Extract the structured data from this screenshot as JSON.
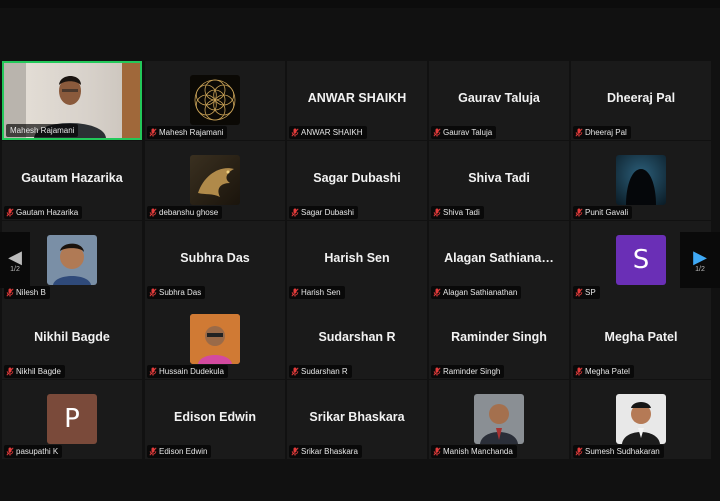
{
  "colors": {
    "background": "#111111",
    "tile": "#1a1a1a",
    "active_border": "#23c85a",
    "mic_muted": "#e23b3b",
    "avatar_s": "#6a2fb6",
    "avatar_p": "#7a4a3a",
    "nav_arrow_right": "#3fa9f5"
  },
  "pager": {
    "left": "1/2",
    "right": "1/2"
  },
  "tiles": [
    {
      "big": "",
      "label": "Mahesh Rajamani",
      "type": "video"
    },
    {
      "big": "",
      "label": "Mahesh Rajamani",
      "type": "image-flower"
    },
    {
      "big": "ANWAR SHAIKH",
      "label": "ANWAR SHAIKH",
      "type": "name"
    },
    {
      "big": "Gaurav Taluja",
      "label": "Gaurav Taluja",
      "type": "name"
    },
    {
      "big": "Dheeraj Pal",
      "label": "Dheeraj Pal",
      "type": "name"
    },
    {
      "big": "Gautam Hazarika",
      "label": "Gautam Hazarika",
      "type": "name"
    },
    {
      "big": "",
      "label": "debanshu ghose",
      "type": "image-dragon"
    },
    {
      "big": "Sagar Dubashi",
      "label": "Sagar Dubashi",
      "type": "name"
    },
    {
      "big": "Shiva Tadi",
      "label": "Shiva Tadi",
      "type": "name"
    },
    {
      "big": "",
      "label": "Punit Gavali",
      "type": "image-hacker"
    },
    {
      "big": "",
      "label": "Nilesh B",
      "type": "image-person1"
    },
    {
      "big": "Subhra Das",
      "label": "Subhra Das",
      "type": "name"
    },
    {
      "big": "Harish Sen",
      "label": "Harish Sen",
      "type": "name"
    },
    {
      "big": "Alagan  Sathiana…",
      "label": "Alagan Sathianathan",
      "type": "name"
    },
    {
      "big": "",
      "label": "SP",
      "type": "letter",
      "letter": "S"
    },
    {
      "big": "Nikhil Bagde",
      "label": "Nikhil Bagde",
      "type": "name"
    },
    {
      "big": "",
      "label": "Hussain Dudekula",
      "type": "image-person2"
    },
    {
      "big": "Sudarshan R",
      "label": "Sudarshan R",
      "type": "name"
    },
    {
      "big": "Raminder Singh",
      "label": "Raminder Singh",
      "type": "name"
    },
    {
      "big": "Megha Patel",
      "label": "Megha Patel",
      "type": "name"
    },
    {
      "big": "",
      "label": "pasupathi K",
      "type": "letter",
      "letter": "P"
    },
    {
      "big": "Edison Edwin",
      "label": "Edison Edwin",
      "type": "name"
    },
    {
      "big": "Srikar Bhaskara",
      "label": "Srikar Bhaskara",
      "type": "name"
    },
    {
      "big": "",
      "label": "Manish Manchanda",
      "type": "image-person3"
    },
    {
      "big": "",
      "label": "Sumesh Sudhakaran",
      "type": "image-person4"
    }
  ]
}
